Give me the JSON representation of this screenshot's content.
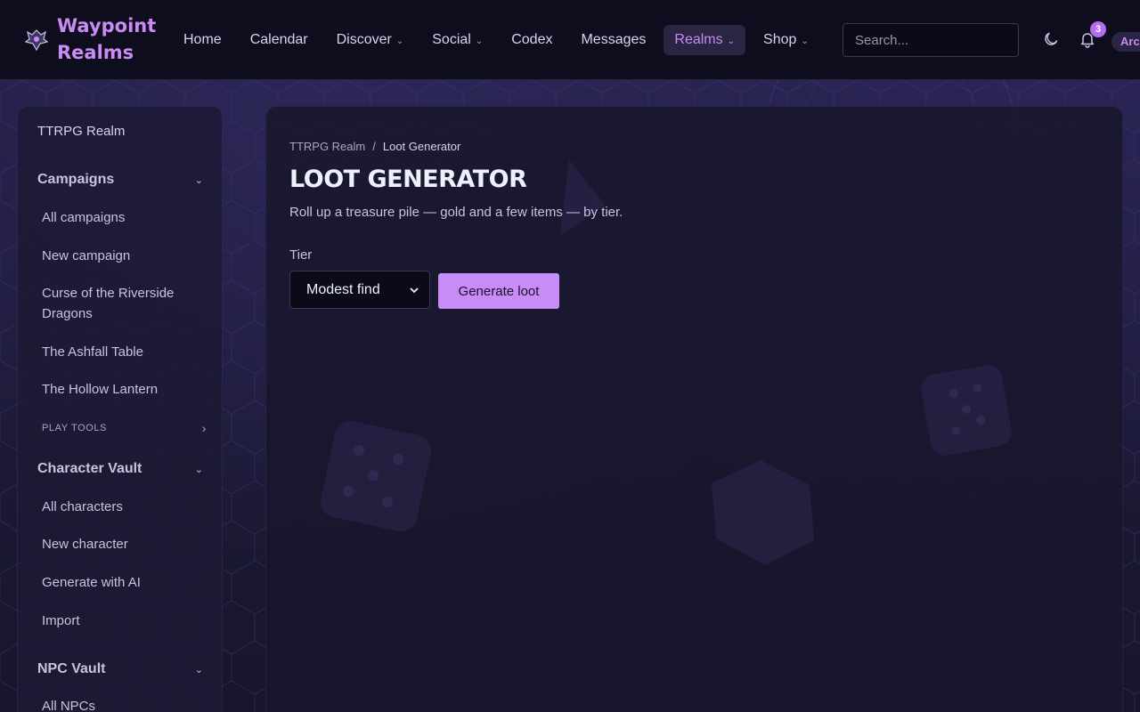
{
  "brand": {
    "line1": "Waypoint",
    "line2": "Realms"
  },
  "nav": {
    "items": [
      {
        "label": "Home",
        "dropdown": false
      },
      {
        "label": "Calendar",
        "dropdown": false
      },
      {
        "label": "Discover",
        "dropdown": true
      },
      {
        "label": "Social",
        "dropdown": true
      },
      {
        "label": "Codex",
        "dropdown": false
      },
      {
        "label": "Messages",
        "dropdown": false
      },
      {
        "label": "Realms",
        "dropdown": true,
        "active": true
      },
      {
        "label": "Shop",
        "dropdown": true
      }
    ],
    "chevron": "⌄"
  },
  "search": {
    "placeholder": "Search..."
  },
  "header_icons": {
    "theme": "moon-icon",
    "notifications": "bell-icon"
  },
  "notifications": {
    "count": "3"
  },
  "user": {
    "label": "Arc"
  },
  "sidebar": {
    "top": "TTRPG Realm",
    "sections": [
      {
        "title": "Campaigns",
        "links": [
          "All campaigns",
          "New campaign",
          "Curse of the Riverside Dragons",
          "The Ashfall Table",
          "The Hollow Lantern"
        ],
        "sub": "PLAY TOOLS"
      },
      {
        "title": "Character Vault",
        "links": [
          "All characters",
          "New character",
          "Generate with AI",
          "Import"
        ]
      },
      {
        "title": "NPC Vault",
        "links": [
          "All NPCs"
        ]
      }
    ],
    "chevron_down": "⌄",
    "chevron_right": "›"
  },
  "main": {
    "breadcrumb": [
      "TTRPG Realm",
      "Loot Generator"
    ],
    "breadcrumb_sep": "/",
    "title": "LOOT GENERATOR",
    "subtitle": "Roll up a treasure pile — gold and a few items — by tier.",
    "tier_label": "Tier",
    "tier_value": "Modest find",
    "button": "Generate loot"
  },
  "colors": {
    "accent": "#c98bf5",
    "nav_bg": "#0e0d1e",
    "panel_bg": "#18162c"
  }
}
